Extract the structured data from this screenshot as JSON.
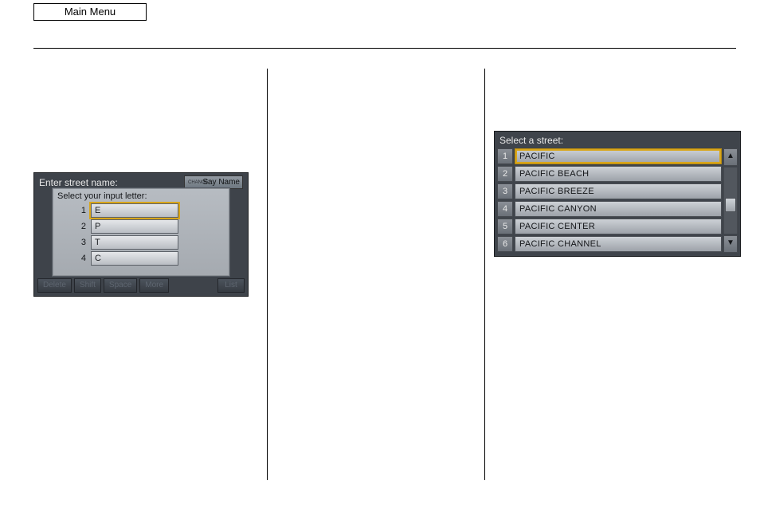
{
  "header": {
    "main_menu": "Main Menu"
  },
  "ss1": {
    "enter_label": "Enter street name:",
    "say_name_small": "CHANGE",
    "say_name": "Say Name",
    "popup_title": "Select your input letter:",
    "rows": [
      {
        "num": "1",
        "letter": "E",
        "selected": true
      },
      {
        "num": "2",
        "letter": "P",
        "selected": false
      },
      {
        "num": "3",
        "letter": "T",
        "selected": false
      },
      {
        "num": "4",
        "letter": "C",
        "selected": false
      }
    ],
    "bottom": {
      "delete": "Delete",
      "shift": "Shift",
      "space": "Space",
      "more": "More",
      "list": "List"
    }
  },
  "ss2": {
    "title": "Select a street:",
    "rows": [
      {
        "num": "1",
        "label": "PACIFIC",
        "selected": true
      },
      {
        "num": "2",
        "label": "PACIFIC BEACH",
        "selected": false
      },
      {
        "num": "3",
        "label": "PACIFIC BREEZE",
        "selected": false
      },
      {
        "num": "4",
        "label": "PACIFIC CANYON",
        "selected": false
      },
      {
        "num": "5",
        "label": "PACIFIC CENTER",
        "selected": false
      },
      {
        "num": "6",
        "label": "PACIFIC CHANNEL",
        "selected": false
      }
    ],
    "arrows": {
      "up": "▲",
      "down": "▼"
    }
  }
}
